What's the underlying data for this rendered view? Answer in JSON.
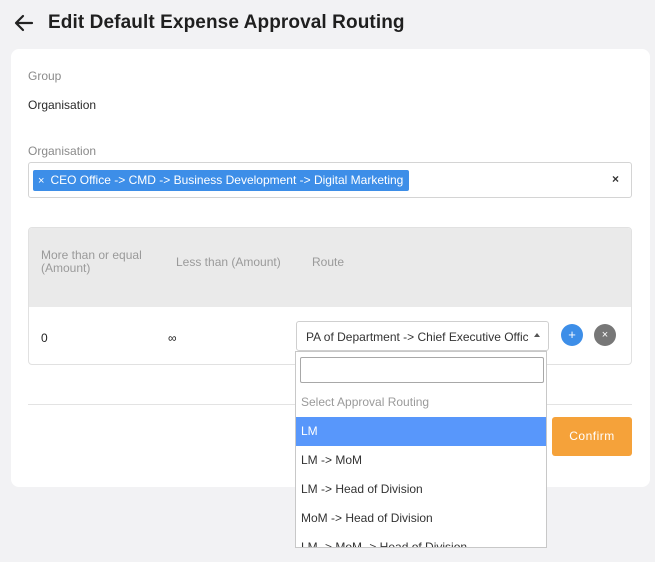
{
  "header": {
    "title": "Edit Default Expense Approval Routing"
  },
  "group": {
    "label": "Group",
    "value": "Organisation"
  },
  "organisation": {
    "label": "Organisation",
    "tag": "CEO Office -> CMD -> Business Development -> Digital Marketing",
    "tag_remove": "×",
    "clear": "×"
  },
  "table": {
    "headers": [
      "More than or equal (Amount)",
      "Less than (Amount)",
      "Route"
    ],
    "rows": [
      {
        "min": "0",
        "max": "∞",
        "route": "PA of Department -> Chief Executive Office..."
      }
    ],
    "add": "+",
    "remove": "×"
  },
  "dropdown": {
    "search_value": "",
    "options": [
      "Select Approval Routing",
      "LM",
      "LM -> MoM",
      "LM -> Head of Division",
      "MoM -> Head of Division",
      "LM -> MoM -> Head of Division"
    ],
    "highlighted": "LM"
  },
  "buttons": {
    "confirm": "Confirm"
  },
  "colors": {
    "accent_blue": "#3d8ee8",
    "highlight_blue": "#5897fb",
    "confirm_orange": "#f5a23a"
  }
}
